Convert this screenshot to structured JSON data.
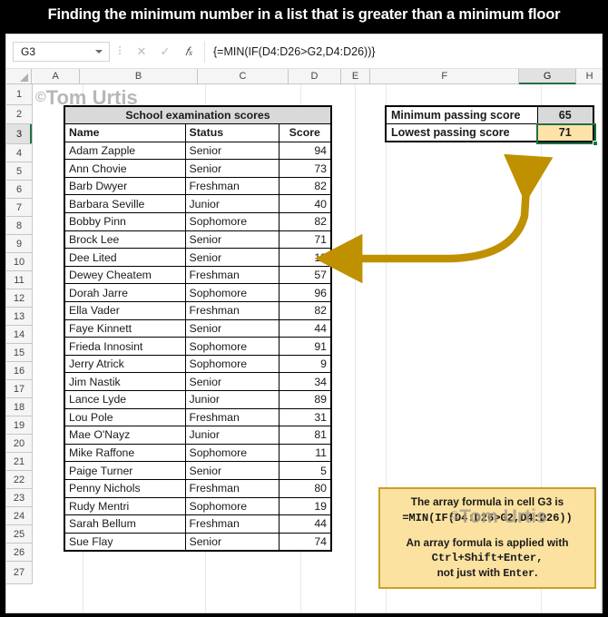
{
  "title": "Finding the minimum number in a list that is greater than a minimum floor",
  "formula_bar": {
    "name_box": "G3",
    "cancel_icon": "times-icon",
    "confirm_icon": "check-icon",
    "function_icon": "fx-icon",
    "formula": "{=MIN(IF(D4:D26>G2,D4:D26))}"
  },
  "grid": {
    "columns": [
      "A",
      "B",
      "C",
      "D",
      "E",
      "F",
      "G",
      "H"
    ],
    "selected_column": "G",
    "rows": [
      "1",
      "2",
      "3",
      "4",
      "5",
      "6",
      "7",
      "8",
      "9",
      "10",
      "11",
      "12",
      "13",
      "14",
      "15",
      "16",
      "17",
      "18",
      "19",
      "20",
      "21",
      "22",
      "23",
      "24",
      "25",
      "26",
      "27"
    ],
    "selected_row": "3"
  },
  "data_table": {
    "title": "School examination scores",
    "headers": [
      "Name",
      "Status",
      "Score"
    ],
    "rows": [
      [
        "Adam Zapple",
        "Senior",
        "94"
      ],
      [
        "Ann Chovie",
        "Senior",
        "73"
      ],
      [
        "Barb Dwyer",
        "Freshman",
        "82"
      ],
      [
        "Barbara Seville",
        "Junior",
        "40"
      ],
      [
        "Bobby Pinn",
        "Sophomore",
        "82"
      ],
      [
        "Brock Lee",
        "Senior",
        "71"
      ],
      [
        "Dee Lited",
        "Senior",
        "19"
      ],
      [
        "Dewey Cheatem",
        "Freshman",
        "57"
      ],
      [
        "Dorah Jarre",
        "Sophomore",
        "96"
      ],
      [
        "Ella Vader",
        "Freshman",
        "82"
      ],
      [
        "Faye Kinnett",
        "Senior",
        "44"
      ],
      [
        "Frieda Innosint",
        "Sophomore",
        "91"
      ],
      [
        "Jerry Atrick",
        "Sophomore",
        "9"
      ],
      [
        "Jim Nastik",
        "Senior",
        "34"
      ],
      [
        "Lance Lyde",
        "Junior",
        "89"
      ],
      [
        "Lou Pole",
        "Freshman",
        "31"
      ],
      [
        "Mae O'Nayz",
        "Junior",
        "81"
      ],
      [
        "Mike Raffone",
        "Sophomore",
        "11"
      ],
      [
        "Paige Turner",
        "Senior",
        "5"
      ],
      [
        "Penny Nichols",
        "Freshman",
        "80"
      ],
      [
        "Rudy Mentri",
        "Sophomore",
        "19"
      ],
      [
        "Sarah Bellum",
        "Freshman",
        "44"
      ],
      [
        "Sue Flay",
        "Senior",
        "74"
      ]
    ]
  },
  "result_box": {
    "min_label": "Minimum passing score",
    "min_value": "65",
    "out_label": "Lowest passing score",
    "out_value": "71"
  },
  "callout": {
    "line1": "The array formula in cell G3 is",
    "line2": "=MIN(IF(D4:D26>G2,D4:D26))",
    "line3": "An array formula is applied with",
    "line4": "Ctrl+Shift+Enter,",
    "line5_a": "not just with ",
    "line5_b": "Enter",
    "line5_c": "."
  },
  "watermark": {
    "text": "Tom Urtis",
    "symbol": "©"
  },
  "colors": {
    "banner_bg": "#000000",
    "banner_fg": "#ffffff",
    "callout_bg": "#fbe2a0",
    "callout_border": "#c8a227",
    "arrow": "#bf9000",
    "selection": "#1f7145",
    "output_cell": "#ffe2a8",
    "header_fill": "#d9d9d9"
  }
}
